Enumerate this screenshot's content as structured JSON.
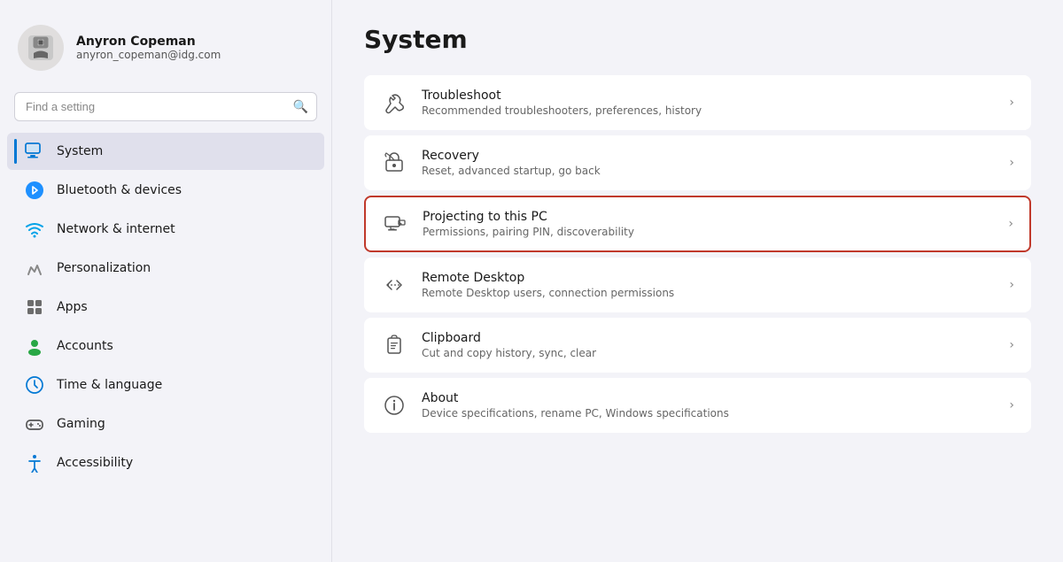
{
  "user": {
    "name": "Anyron Copeman",
    "email": "anyron_copeman@idg.com"
  },
  "search": {
    "placeholder": "Find a setting"
  },
  "page_title": "System",
  "sidebar": {
    "items": [
      {
        "id": "system",
        "label": "System",
        "active": true
      },
      {
        "id": "bluetooth",
        "label": "Bluetooth & devices",
        "active": false
      },
      {
        "id": "network",
        "label": "Network & internet",
        "active": false
      },
      {
        "id": "personalization",
        "label": "Personalization",
        "active": false
      },
      {
        "id": "apps",
        "label": "Apps",
        "active": false
      },
      {
        "id": "accounts",
        "label": "Accounts",
        "active": false
      },
      {
        "id": "time",
        "label": "Time & language",
        "active": false
      },
      {
        "id": "gaming",
        "label": "Gaming",
        "active": false
      },
      {
        "id": "accessibility",
        "label": "Accessibility",
        "active": false
      }
    ]
  },
  "settings": [
    {
      "id": "troubleshoot",
      "title": "Troubleshoot",
      "description": "Recommended troubleshooters, preferences, history",
      "highlighted": false
    },
    {
      "id": "recovery",
      "title": "Recovery",
      "description": "Reset, advanced startup, go back",
      "highlighted": false
    },
    {
      "id": "projecting",
      "title": "Projecting to this PC",
      "description": "Permissions, pairing PIN, discoverability",
      "highlighted": true
    },
    {
      "id": "remote-desktop",
      "title": "Remote Desktop",
      "description": "Remote Desktop users, connection permissions",
      "highlighted": false
    },
    {
      "id": "clipboard",
      "title": "Clipboard",
      "description": "Cut and copy history, sync, clear",
      "highlighted": false
    },
    {
      "id": "about",
      "title": "About",
      "description": "Device specifications, rename PC, Windows specifications",
      "highlighted": false
    }
  ]
}
